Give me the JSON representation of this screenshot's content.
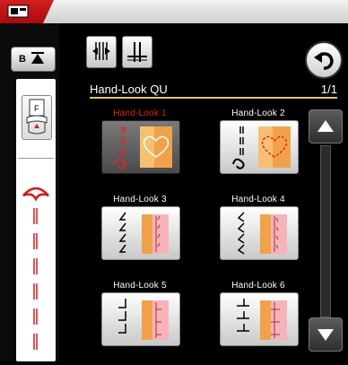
{
  "topbar": {
    "tab_icon": "machine-tab-icon"
  },
  "sidebar": {
    "bobbin_button_label": "B",
    "foot_icon": "presser-foot-icon",
    "foot_letter": "F"
  },
  "toolbar": {
    "button1_icon": "stitch-mirror-icon",
    "button2_icon": "needle-position-icon",
    "back_icon": "back-arrow-icon"
  },
  "main": {
    "category_title": "Hand-Look QU",
    "page_indicator": "1/1",
    "stitches": [
      {
        "label": "Hand-Look 1",
        "selected": true
      },
      {
        "label": "Hand-Look 2",
        "selected": false
      },
      {
        "label": "Hand-Look 3",
        "selected": false
      },
      {
        "label": "Hand-Look 4",
        "selected": false
      },
      {
        "label": "Hand-Look 5",
        "selected": false
      },
      {
        "label": "Hand-Look 6",
        "selected": false
      }
    ]
  },
  "scroll": {
    "up_icon": "scroll-up-icon",
    "down_icon": "scroll-down-icon"
  },
  "colors": {
    "accent_red": "#e02525",
    "rule_gold": "#e4c36a",
    "fabric_orange": "#f0a24a",
    "fabric_pink": "#f7b3b9"
  }
}
